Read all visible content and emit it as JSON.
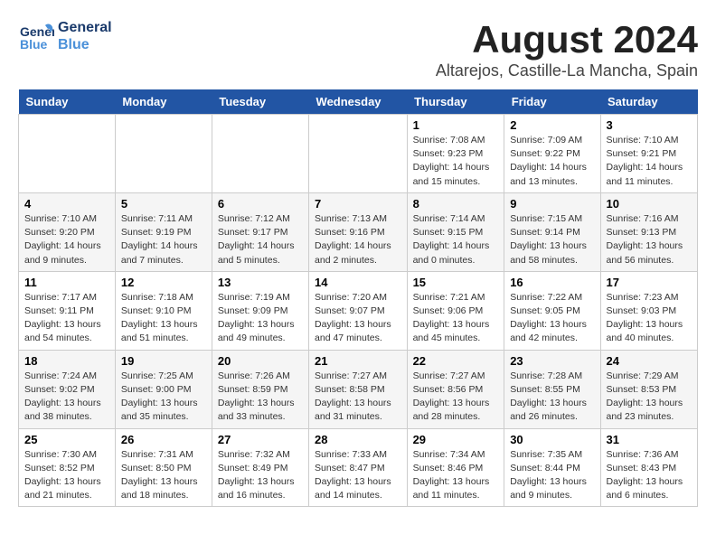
{
  "header": {
    "logo_general": "General",
    "logo_blue": "Blue",
    "month": "August 2024",
    "location": "Altarejos, Castille-La Mancha, Spain"
  },
  "days_of_week": [
    "Sunday",
    "Monday",
    "Tuesday",
    "Wednesday",
    "Thursday",
    "Friday",
    "Saturday"
  ],
  "weeks": [
    [
      {
        "day": "",
        "info": ""
      },
      {
        "day": "",
        "info": ""
      },
      {
        "day": "",
        "info": ""
      },
      {
        "day": "",
        "info": ""
      },
      {
        "day": "1",
        "info": "Sunrise: 7:08 AM\nSunset: 9:23 PM\nDaylight: 14 hours\nand 15 minutes."
      },
      {
        "day": "2",
        "info": "Sunrise: 7:09 AM\nSunset: 9:22 PM\nDaylight: 14 hours\nand 13 minutes."
      },
      {
        "day": "3",
        "info": "Sunrise: 7:10 AM\nSunset: 9:21 PM\nDaylight: 14 hours\nand 11 minutes."
      }
    ],
    [
      {
        "day": "4",
        "info": "Sunrise: 7:10 AM\nSunset: 9:20 PM\nDaylight: 14 hours\nand 9 minutes."
      },
      {
        "day": "5",
        "info": "Sunrise: 7:11 AM\nSunset: 9:19 PM\nDaylight: 14 hours\nand 7 minutes."
      },
      {
        "day": "6",
        "info": "Sunrise: 7:12 AM\nSunset: 9:17 PM\nDaylight: 14 hours\nand 5 minutes."
      },
      {
        "day": "7",
        "info": "Sunrise: 7:13 AM\nSunset: 9:16 PM\nDaylight: 14 hours\nand 2 minutes."
      },
      {
        "day": "8",
        "info": "Sunrise: 7:14 AM\nSunset: 9:15 PM\nDaylight: 14 hours\nand 0 minutes."
      },
      {
        "day": "9",
        "info": "Sunrise: 7:15 AM\nSunset: 9:14 PM\nDaylight: 13 hours\nand 58 minutes."
      },
      {
        "day": "10",
        "info": "Sunrise: 7:16 AM\nSunset: 9:13 PM\nDaylight: 13 hours\nand 56 minutes."
      }
    ],
    [
      {
        "day": "11",
        "info": "Sunrise: 7:17 AM\nSunset: 9:11 PM\nDaylight: 13 hours\nand 54 minutes."
      },
      {
        "day": "12",
        "info": "Sunrise: 7:18 AM\nSunset: 9:10 PM\nDaylight: 13 hours\nand 51 minutes."
      },
      {
        "day": "13",
        "info": "Sunrise: 7:19 AM\nSunset: 9:09 PM\nDaylight: 13 hours\nand 49 minutes."
      },
      {
        "day": "14",
        "info": "Sunrise: 7:20 AM\nSunset: 9:07 PM\nDaylight: 13 hours\nand 47 minutes."
      },
      {
        "day": "15",
        "info": "Sunrise: 7:21 AM\nSunset: 9:06 PM\nDaylight: 13 hours\nand 45 minutes."
      },
      {
        "day": "16",
        "info": "Sunrise: 7:22 AM\nSunset: 9:05 PM\nDaylight: 13 hours\nand 42 minutes."
      },
      {
        "day": "17",
        "info": "Sunrise: 7:23 AM\nSunset: 9:03 PM\nDaylight: 13 hours\nand 40 minutes."
      }
    ],
    [
      {
        "day": "18",
        "info": "Sunrise: 7:24 AM\nSunset: 9:02 PM\nDaylight: 13 hours\nand 38 minutes."
      },
      {
        "day": "19",
        "info": "Sunrise: 7:25 AM\nSunset: 9:00 PM\nDaylight: 13 hours\nand 35 minutes."
      },
      {
        "day": "20",
        "info": "Sunrise: 7:26 AM\nSunset: 8:59 PM\nDaylight: 13 hours\nand 33 minutes."
      },
      {
        "day": "21",
        "info": "Sunrise: 7:27 AM\nSunset: 8:58 PM\nDaylight: 13 hours\nand 31 minutes."
      },
      {
        "day": "22",
        "info": "Sunrise: 7:27 AM\nSunset: 8:56 PM\nDaylight: 13 hours\nand 28 minutes."
      },
      {
        "day": "23",
        "info": "Sunrise: 7:28 AM\nSunset: 8:55 PM\nDaylight: 13 hours\nand 26 minutes."
      },
      {
        "day": "24",
        "info": "Sunrise: 7:29 AM\nSunset: 8:53 PM\nDaylight: 13 hours\nand 23 minutes."
      }
    ],
    [
      {
        "day": "25",
        "info": "Sunrise: 7:30 AM\nSunset: 8:52 PM\nDaylight: 13 hours\nand 21 minutes."
      },
      {
        "day": "26",
        "info": "Sunrise: 7:31 AM\nSunset: 8:50 PM\nDaylight: 13 hours\nand 18 minutes."
      },
      {
        "day": "27",
        "info": "Sunrise: 7:32 AM\nSunset: 8:49 PM\nDaylight: 13 hours\nand 16 minutes."
      },
      {
        "day": "28",
        "info": "Sunrise: 7:33 AM\nSunset: 8:47 PM\nDaylight: 13 hours\nand 14 minutes."
      },
      {
        "day": "29",
        "info": "Sunrise: 7:34 AM\nSunset: 8:46 PM\nDaylight: 13 hours\nand 11 minutes."
      },
      {
        "day": "30",
        "info": "Sunrise: 7:35 AM\nSunset: 8:44 PM\nDaylight: 13 hours\nand 9 minutes."
      },
      {
        "day": "31",
        "info": "Sunrise: 7:36 AM\nSunset: 8:43 PM\nDaylight: 13 hours\nand 6 minutes."
      }
    ]
  ]
}
